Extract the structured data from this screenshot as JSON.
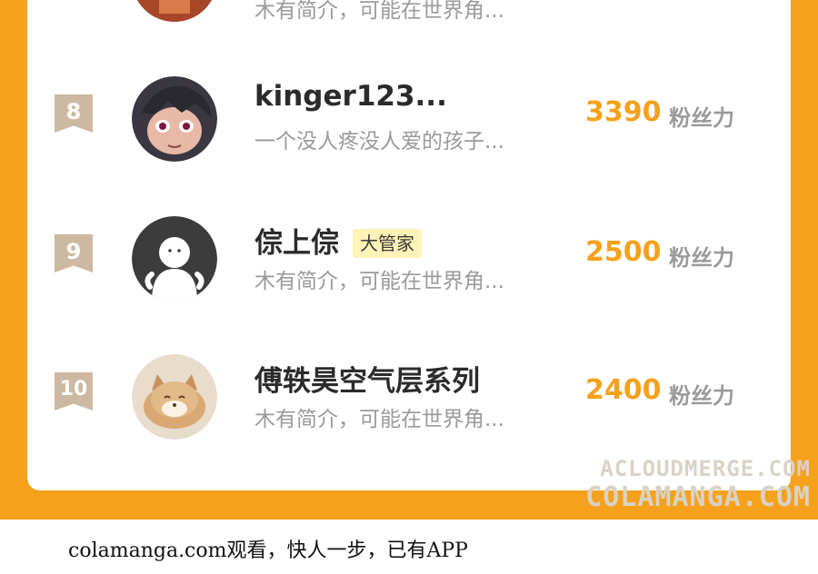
{
  "ranking": {
    "top_partial": {
      "bio": "木有简介，可能在世界角..."
    },
    "entries": [
      {
        "rank": "8",
        "name": "kinger123...",
        "bio": "一个没人疼没人爱的孩子...",
        "score": "3390",
        "unit": "粉丝力"
      },
      {
        "rank": "9",
        "name": "倧上倧",
        "badge": "大管家",
        "bio": "木有简介，可能在世界角...",
        "score": "2500",
        "unit": "粉丝力"
      },
      {
        "rank": "10",
        "name": "傅轶昊空气层系列",
        "bio": "木有简介，可能在世界角...",
        "score": "2400",
        "unit": "粉丝力"
      }
    ]
  },
  "watermark": {
    "line1": "ACLOUDMERGE.COM",
    "line2": "COLAMANGA.COM"
  },
  "footer": {
    "text": "colamanga.com观看，快人一步，已有APP"
  },
  "colors": {
    "frame": "#f5a11c",
    "score": "#f5a11c",
    "rank_badge": "#cdb9a2",
    "role_badge": "#fff3b8"
  }
}
